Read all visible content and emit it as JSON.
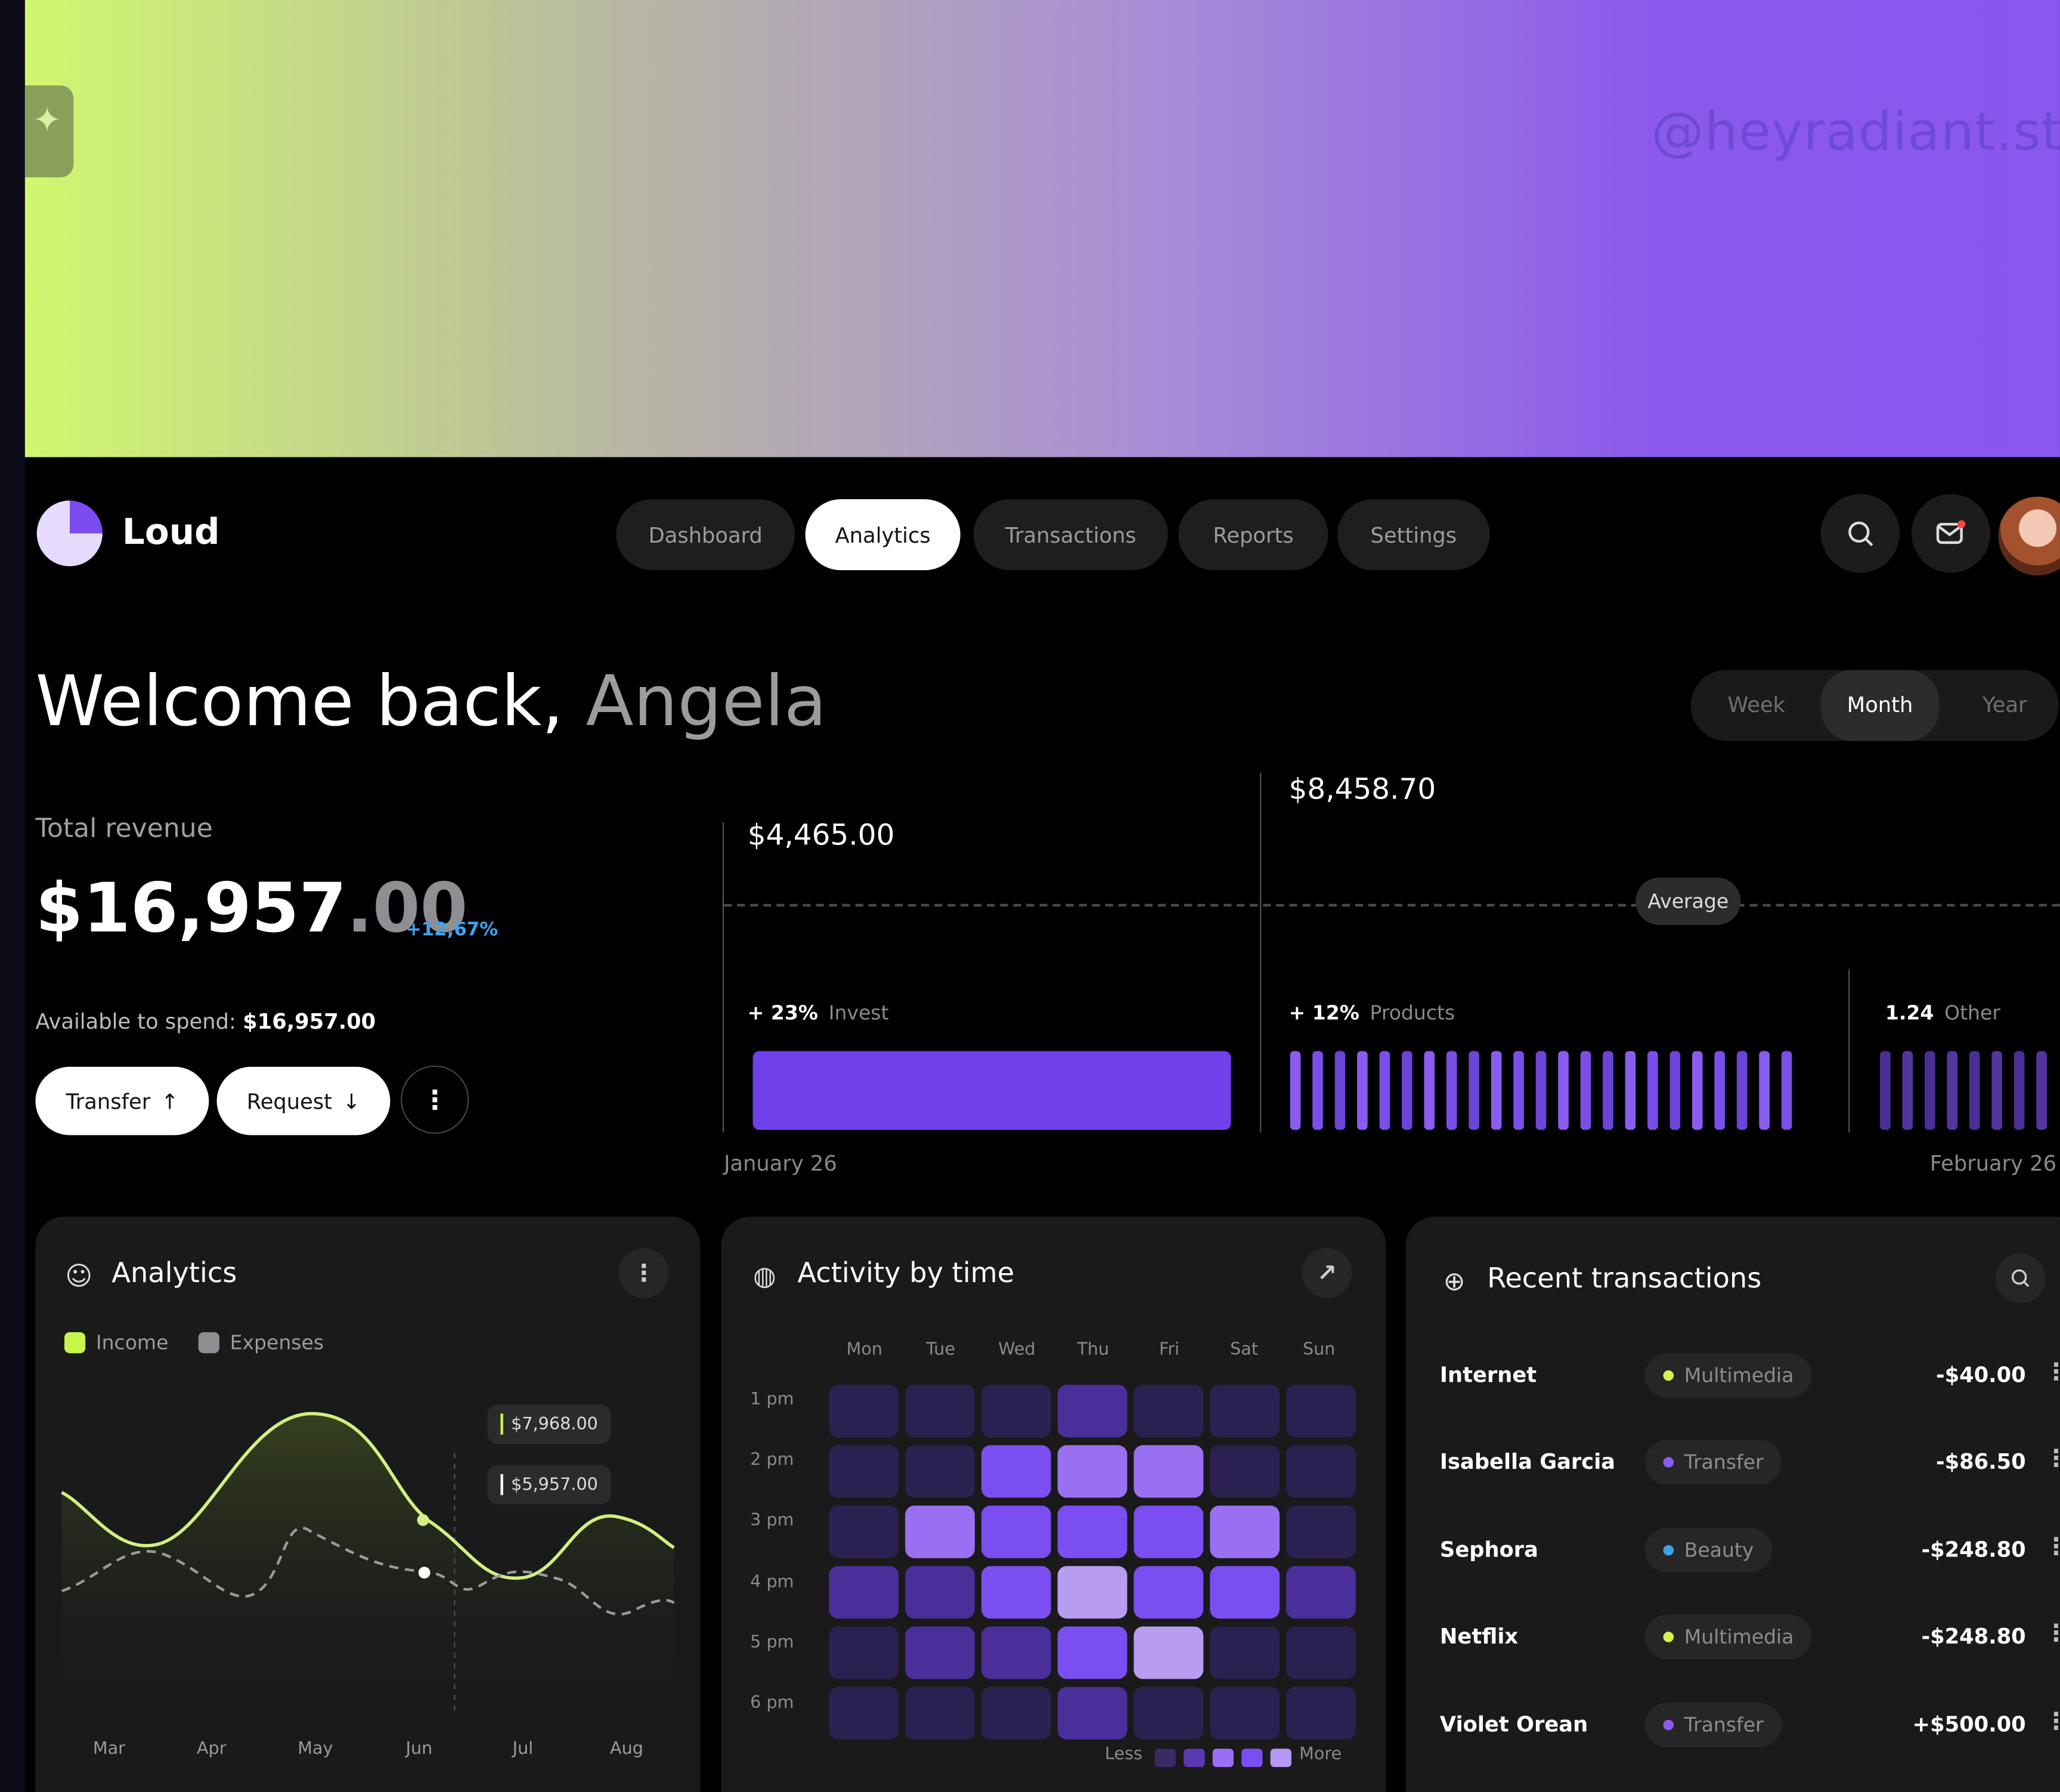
{
  "watermark": "@heyradiant.stud",
  "brand": {
    "name": "Loud"
  },
  "nav": [
    {
      "label": "Dashboard",
      "active": false
    },
    {
      "label": "Analytics",
      "active": true
    },
    {
      "label": "Transactions",
      "active": false
    },
    {
      "label": "Reports",
      "active": false
    },
    {
      "label": "Settings",
      "active": false
    }
  ],
  "header_icons": [
    "search-icon",
    "mail-icon",
    "avatar"
  ],
  "welcome": {
    "greeting": "Welcome back,",
    "name": "Angela"
  },
  "period": {
    "options": [
      "Week",
      "Month",
      "Year"
    ],
    "selected": "Month"
  },
  "revenue": {
    "label": "Total revenue",
    "amount_main": "$16,957",
    "amount_cents": ".00",
    "change": "+12,67%",
    "available_label": "Available to spend:",
    "available_value": "$16,957.00"
  },
  "actions": {
    "transfer": "Transfer",
    "request": "Request",
    "transfer_icon": "arrow-up-icon",
    "request_icon": "arrow-down-icon"
  },
  "breakdown": {
    "value_1": "$4,465.00",
    "value_2": "$8,458.70",
    "average_label": "Average",
    "invest": {
      "pct": "+ 23%",
      "label": "Invest"
    },
    "products": {
      "pct": "+ 12%",
      "label": "Products"
    },
    "other": {
      "pct": "1.24",
      "label": "Other"
    },
    "start_date": "January 26",
    "end_date": "February 26"
  },
  "analytics_card": {
    "title": "Analytics",
    "legend": [
      {
        "label": "Income",
        "color": "#c9f44a"
      },
      {
        "label": "Expenses",
        "color": "#8e8e92"
      }
    ],
    "tooltip_income": "$7,968.00",
    "tooltip_expenses": "$5,957.00",
    "months": [
      "Mar",
      "Apr",
      "May",
      "Jun",
      "Jul",
      "Aug"
    ]
  },
  "activity_card": {
    "title": "Activity by time",
    "days": [
      "Mon",
      "Tue",
      "Wed",
      "Thu",
      "Fri",
      "Sat",
      "Sun"
    ],
    "hours": [
      "1 pm",
      "2 pm",
      "3 pm",
      "4 pm",
      "5 pm",
      "6 pm"
    ],
    "grid": [
      [
        1,
        1,
        1,
        2,
        1,
        1,
        1
      ],
      [
        1,
        1,
        3,
        4,
        4,
        1,
        1
      ],
      [
        1,
        4,
        3,
        3,
        3,
        4,
        1
      ],
      [
        2,
        2,
        3,
        5,
        3,
        3,
        2
      ],
      [
        1,
        2,
        2,
        3,
        5,
        1,
        1
      ],
      [
        1,
        1,
        1,
        2,
        1,
        1,
        1
      ]
    ],
    "scale_less": "Less",
    "scale_more": "More"
  },
  "transactions_card": {
    "title": "Recent transactions",
    "rows": [
      {
        "name": "Internet",
        "category": "Multimedia",
        "dot": "#d8f150",
        "amount": "-$40.00"
      },
      {
        "name": "Isabella Garcia",
        "category": "Transfer",
        "dot": "#8a5cf0",
        "amount": "-$86.50"
      },
      {
        "name": "Sephora",
        "category": "Beauty",
        "dot": "#3da1e8",
        "amount": "-$248.80"
      },
      {
        "name": "Netflix",
        "category": "Multimedia",
        "dot": "#d8f150",
        "amount": "-$248.80"
      },
      {
        "name": "Violet Orean",
        "category": "Transfer",
        "dot": "#8a5cf0",
        "amount": "+$500.00"
      }
    ]
  },
  "colors": {
    "accent": "#7040ea",
    "income": "#c9f44a",
    "change": "#3ea4f2"
  }
}
